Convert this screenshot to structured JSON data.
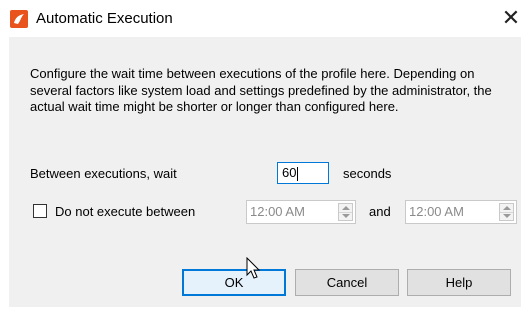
{
  "window": {
    "title": "Automatic Execution",
    "close_glyph": "✕"
  },
  "description": "Configure the wait time between executions of the profile here. Depending on several factors like system load and settings predefined by the administrator, the actual wait time might be shorter or longer than configured here.",
  "wait": {
    "label": "Between executions, wait",
    "value": "60",
    "unit": "seconds"
  },
  "exclusion": {
    "checkbox_label": "Do not execute between",
    "checked": false,
    "start_time": "12:00 AM",
    "and_label": "and",
    "end_time": "12:00 AM"
  },
  "buttons": {
    "ok": "OK",
    "cancel": "Cancel",
    "help": "Help"
  },
  "colors": {
    "accent": "#0078d7",
    "app_icon": "#e8541c",
    "dialog_bg": "#f0f0f0"
  }
}
